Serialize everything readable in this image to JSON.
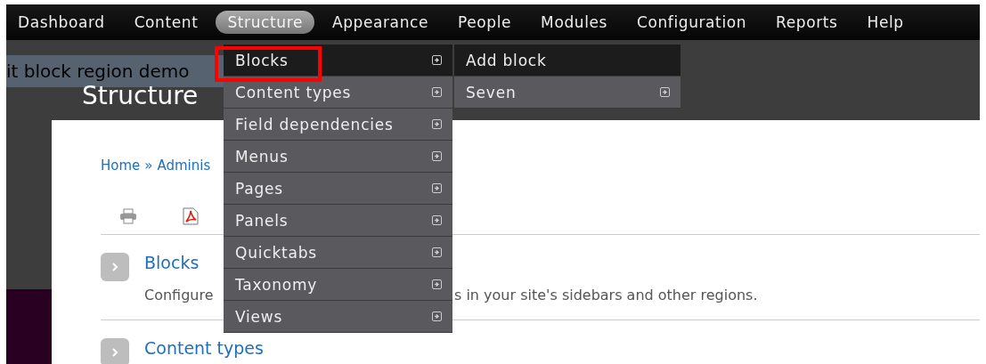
{
  "nav": [
    {
      "label": "Dashboard",
      "selected": false
    },
    {
      "label": "Content",
      "selected": false
    },
    {
      "label": "Structure",
      "selected": true
    },
    {
      "label": "Appearance",
      "selected": false
    },
    {
      "label": "People",
      "selected": false
    },
    {
      "label": "Modules",
      "selected": false
    },
    {
      "label": "Configuration",
      "selected": false
    },
    {
      "label": "Reports",
      "selected": false
    },
    {
      "label": "Help",
      "selected": false
    }
  ],
  "banner_text": "it block region demo",
  "page_title": "Structure",
  "breadcrumb": [
    {
      "label": "Home"
    },
    {
      "label": "Adminis"
    }
  ],
  "breadcrumb_separator": "»",
  "sections": [
    {
      "title": "Blocks",
      "description_parts": [
        "Configure",
        "s in your site's sidebars and other regions."
      ]
    },
    {
      "title": "Content types"
    }
  ],
  "menu": {
    "items": [
      {
        "label": "Blocks",
        "selected": true,
        "highlighted": true,
        "has_submenu": true
      },
      {
        "label": "Content types",
        "selected": false,
        "highlighted": false,
        "has_submenu": true
      },
      {
        "label": "Field dependencies",
        "selected": false,
        "highlighted": false,
        "has_submenu": true
      },
      {
        "label": "Menus",
        "selected": false,
        "highlighted": false,
        "has_submenu": true
      },
      {
        "label": "Pages",
        "selected": false,
        "highlighted": false,
        "has_submenu": true
      },
      {
        "label": "Panels",
        "selected": false,
        "highlighted": false,
        "has_submenu": true
      },
      {
        "label": "Quicktabs",
        "selected": false,
        "highlighted": false,
        "has_submenu": true
      },
      {
        "label": "Taxonomy",
        "selected": false,
        "highlighted": false,
        "has_submenu": true
      },
      {
        "label": "Views",
        "selected": false,
        "highlighted": false,
        "has_submenu": true
      }
    ],
    "submenu": [
      {
        "label": "Add block",
        "selected": true,
        "has_submenu": false
      },
      {
        "label": "Seven",
        "selected": false,
        "has_submenu": true
      }
    ]
  }
}
